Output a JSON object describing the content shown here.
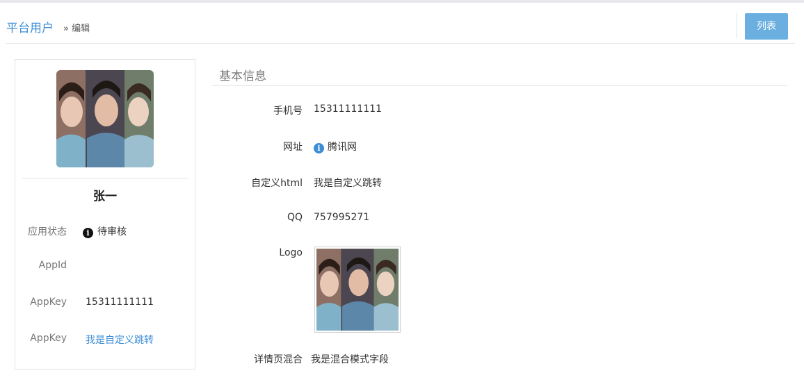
{
  "header": {
    "title": "平台用户",
    "breadcrumb": "» 编辑",
    "list_button": "列表"
  },
  "profile": {
    "name": "张一",
    "rows": [
      {
        "label": "应用状态",
        "value": "待审核"
      },
      {
        "label": "AppId",
        "value": ""
      },
      {
        "label": "AppKey",
        "value": "15311111111"
      },
      {
        "label": "AppKey",
        "value": "我是自定义跳转"
      }
    ]
  },
  "basic_info": {
    "section_title": "基本信息",
    "fields": [
      {
        "label": "手机号",
        "value": "15311111111"
      },
      {
        "label": "网址",
        "value": "腾讯网"
      },
      {
        "label": "自定义html",
        "value": "我是自定义跳转"
      },
      {
        "label": "QQ",
        "value": "757995271"
      },
      {
        "label": "Logo",
        "value": ""
      },
      {
        "label": "详情页混合",
        "value": "我是混合模式字段"
      }
    ]
  },
  "icons": {
    "status": "info-circle-icon",
    "website": "info-circle-icon"
  },
  "colors": {
    "accent": "#3c8dd6",
    "button": "#6aafe0"
  }
}
